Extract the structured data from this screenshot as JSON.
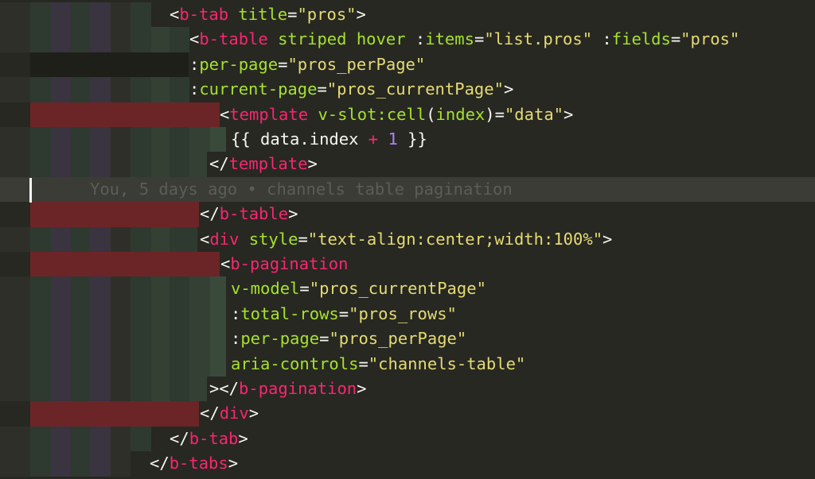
{
  "editor": {
    "lines": [
      {
        "id": "l1",
        "tokens": [
          [
            "punct",
            "<"
          ],
          [
            "tag",
            "b-tab"
          ],
          [
            "punct",
            " "
          ],
          [
            "attr",
            "title"
          ],
          [
            "punct",
            "="
          ],
          [
            "str",
            "\"pros\""
          ],
          [
            "punct",
            ">"
          ]
        ]
      },
      {
        "id": "l2",
        "tokens": [
          [
            "punct",
            "<"
          ],
          [
            "tag",
            "b-table"
          ],
          [
            "punct",
            " "
          ],
          [
            "attr",
            "striped"
          ],
          [
            "punct",
            " "
          ],
          [
            "attr",
            "hover"
          ],
          [
            "punct",
            " :"
          ],
          [
            "attr",
            "items"
          ],
          [
            "punct",
            "="
          ],
          [
            "str",
            "\"list.pros\""
          ],
          [
            "punct",
            " :"
          ],
          [
            "attr",
            "fields"
          ],
          [
            "punct",
            "="
          ],
          [
            "str",
            "\"pros\""
          ]
        ]
      },
      {
        "id": "l3",
        "tokens": [
          [
            "punct",
            ":"
          ],
          [
            "attr",
            "per-page"
          ],
          [
            "punct",
            "="
          ],
          [
            "str",
            "\"pros_perPage\""
          ]
        ]
      },
      {
        "id": "l4",
        "tokens": [
          [
            "punct",
            ":"
          ],
          [
            "attr",
            "current-page"
          ],
          [
            "punct",
            "="
          ],
          [
            "str",
            "\"pros_currentPage\""
          ],
          [
            "punct",
            ">"
          ]
        ]
      },
      {
        "id": "l5",
        "tokens": [
          [
            "punct",
            "<"
          ],
          [
            "tag",
            "template"
          ],
          [
            "punct",
            " "
          ],
          [
            "attr",
            "v-slot:cell"
          ],
          [
            "punct",
            "("
          ],
          [
            "attr",
            "index"
          ],
          [
            "punct",
            ")="
          ],
          [
            "str",
            "\"data\""
          ],
          [
            "punct",
            ">"
          ]
        ]
      },
      {
        "id": "l6",
        "tokens": [
          [
            "punct",
            "{{ data.index "
          ],
          [
            "op",
            "+"
          ],
          [
            "punct",
            " "
          ],
          [
            "num",
            "1"
          ],
          [
            "punct",
            " }}"
          ]
        ]
      },
      {
        "id": "l7",
        "tokens": [
          [
            "punct",
            "</"
          ],
          [
            "tag",
            "template"
          ],
          [
            "punct",
            ">"
          ]
        ]
      },
      {
        "id": "l8",
        "tokens": [
          [
            "blame",
            "You, 5 days ago • channels table pagination"
          ]
        ]
      },
      {
        "id": "l9",
        "tokens": [
          [
            "punct",
            "</"
          ],
          [
            "tag",
            "b-table"
          ],
          [
            "punct",
            ">"
          ]
        ]
      },
      {
        "id": "l10",
        "tokens": [
          [
            "punct",
            "<"
          ],
          [
            "tag",
            "div"
          ],
          [
            "punct",
            " "
          ],
          [
            "attr",
            "style"
          ],
          [
            "punct",
            "="
          ],
          [
            "str",
            "\"text-align:center;width:100%\""
          ],
          [
            "punct",
            ">"
          ]
        ]
      },
      {
        "id": "l11",
        "tokens": [
          [
            "punct",
            "<"
          ],
          [
            "tag",
            "b-pagination"
          ]
        ]
      },
      {
        "id": "l12",
        "tokens": [
          [
            "attr",
            "v-model"
          ],
          [
            "punct",
            "="
          ],
          [
            "str",
            "\"pros_currentPage\""
          ]
        ]
      },
      {
        "id": "l13",
        "tokens": [
          [
            "punct",
            ":"
          ],
          [
            "attr",
            "total-rows"
          ],
          [
            "punct",
            "="
          ],
          [
            "str",
            "\"pros_rows\""
          ]
        ]
      },
      {
        "id": "l14",
        "tokens": [
          [
            "punct",
            ":"
          ],
          [
            "attr",
            "per-page"
          ],
          [
            "punct",
            "="
          ],
          [
            "str",
            "\"pros_perPage\""
          ]
        ]
      },
      {
        "id": "l15",
        "tokens": [
          [
            "attr",
            "aria-controls"
          ],
          [
            "punct",
            "="
          ],
          [
            "str",
            "\"channels-table\""
          ]
        ]
      },
      {
        "id": "l16",
        "tokens": [
          [
            "punct",
            "></"
          ],
          [
            "tag",
            "b-pagination"
          ],
          [
            "punct",
            ">"
          ]
        ]
      },
      {
        "id": "l17",
        "tokens": [
          [
            "punct",
            "</"
          ],
          [
            "tag",
            "div"
          ],
          [
            "punct",
            ">"
          ]
        ]
      },
      {
        "id": "l18",
        "tokens": [
          [
            "punct",
            "</"
          ],
          [
            "tag",
            "b-tab"
          ],
          [
            "punct",
            ">"
          ]
        ]
      },
      {
        "id": "l19",
        "tokens": [
          [
            "punct",
            "</"
          ],
          [
            "tag",
            "b-tabs"
          ],
          [
            "punct",
            ">"
          ]
        ]
      }
    ]
  },
  "colors": {
    "background": "#272822",
    "tag": "#f92672",
    "attribute": "#a6e22e",
    "string": "#e6db74",
    "number": "#ae81ff",
    "text": "#f8f8f2",
    "blame": "#5c5d57",
    "indent_guide": "#3a4a3a",
    "error_band": "#6b2526"
  }
}
